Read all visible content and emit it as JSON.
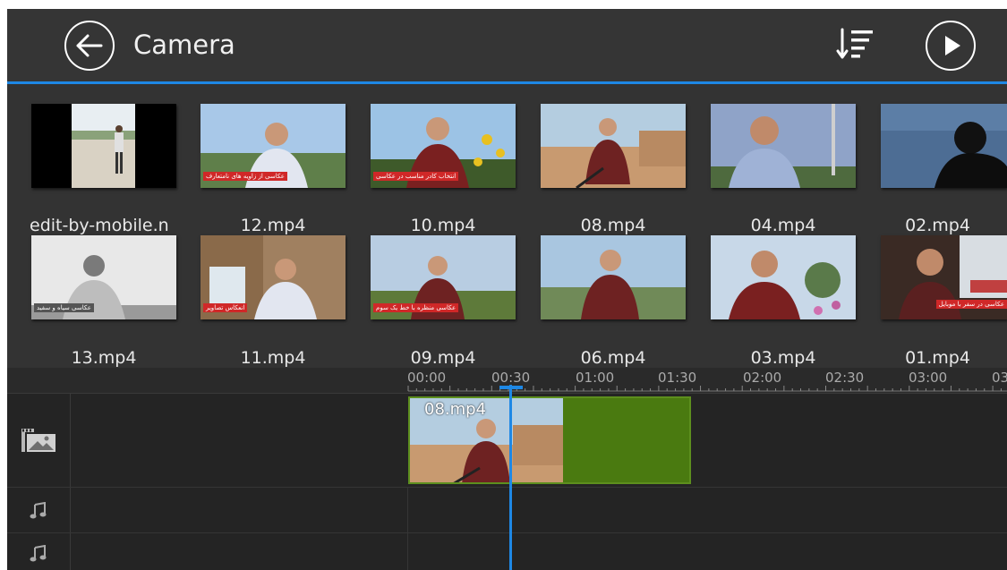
{
  "header": {
    "title": "Camera",
    "back_icon": "arrow-left-icon",
    "sort_icon": "sort-icon",
    "play_icon": "play-icon"
  },
  "gallery": {
    "items": [
      {
        "name": "edit-by-mobile.n",
        "banner": ""
      },
      {
        "name": "12.mp4",
        "banner": "عکاسی از زاویه های نامتعارف"
      },
      {
        "name": "10.mp4",
        "banner": "انتخاب کادر مناسب در عکاسی"
      },
      {
        "name": "08.mp4",
        "banner": ""
      },
      {
        "name": "04.mp4",
        "banner": ""
      },
      {
        "name": "02.mp4",
        "banner": ""
      },
      {
        "name": "13.mp4",
        "banner": "عکاسی سیاه و سفید"
      },
      {
        "name": "11.mp4",
        "banner": "انعکاس تصاویر"
      },
      {
        "name": "09.mp4",
        "banner": "عکاسی منظره با خط یک سوم"
      },
      {
        "name": "06.mp4",
        "banner": ""
      },
      {
        "name": "03.mp4",
        "banner": ""
      },
      {
        "name": "01.mp4",
        "banner": "عکاسی در سفر با موبایل"
      }
    ]
  },
  "timeline": {
    "ticks": [
      "00:00",
      "00:30",
      "01:00",
      "01:30",
      "02:00",
      "02:30",
      "03:00",
      "03"
    ],
    "clip_label": "08.mp4",
    "video_track_icon": "video-track-icon",
    "music_track_icon": "music-note-icon"
  },
  "colors": {
    "accent": "#1e88e5",
    "clip_green": "#4a7a10"
  }
}
